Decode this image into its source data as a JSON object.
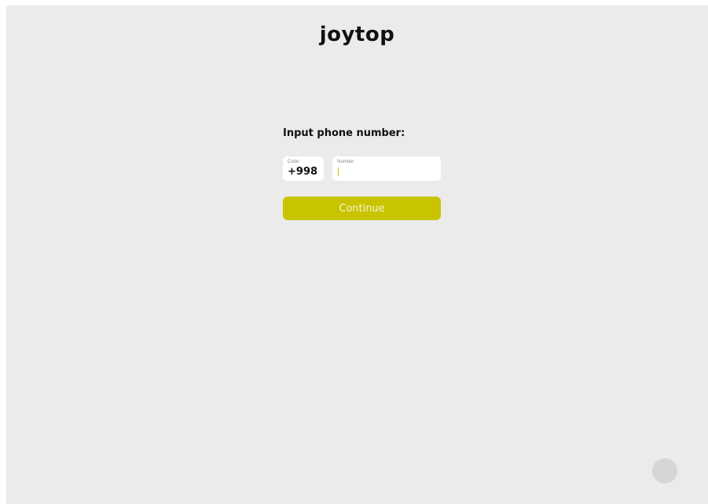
{
  "app": {
    "logo_text": "joytop"
  },
  "form": {
    "prompt": "Input phone number:",
    "code": {
      "caption": "Code",
      "value": "+998"
    },
    "number": {
      "caption": "Number",
      "value": ""
    },
    "continue_label": "Continue"
  },
  "colors": {
    "background": "#ebebeb",
    "accent": "#c9c400",
    "field_background": "#ffffff",
    "fab": "#d6d6d6"
  },
  "icons": {
    "floating_button": "round-action-button"
  }
}
